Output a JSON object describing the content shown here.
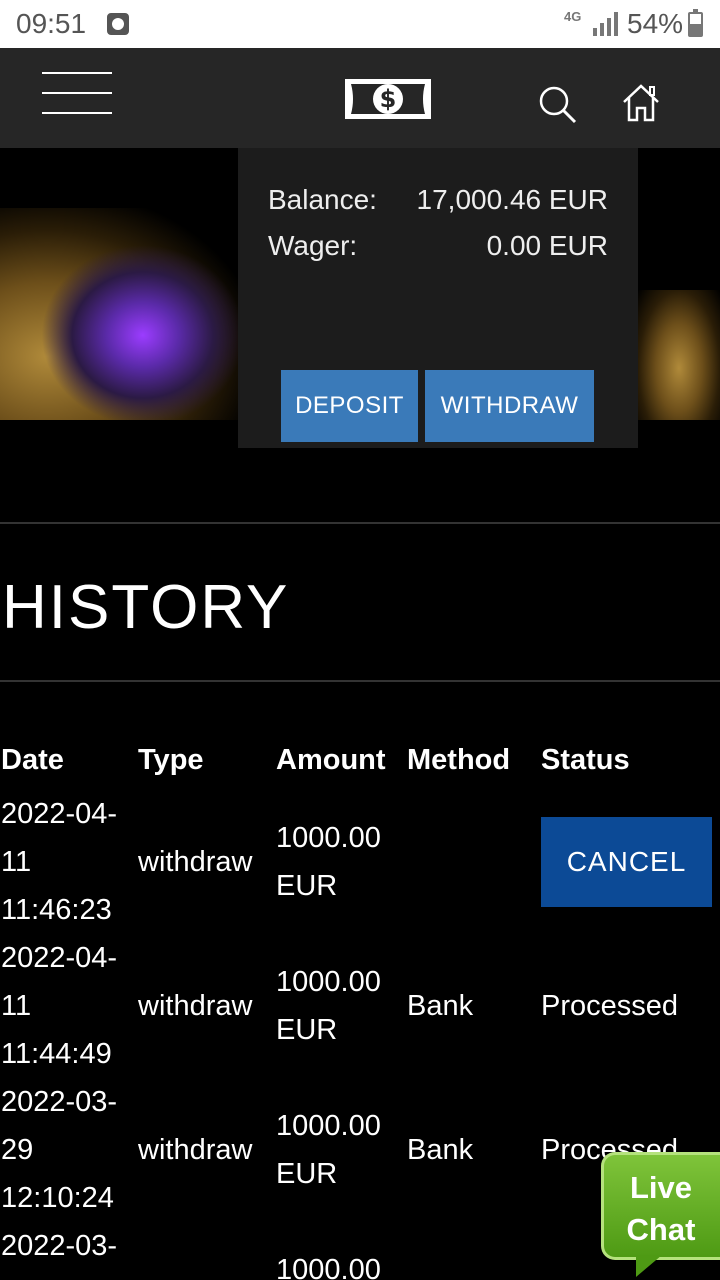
{
  "status_bar": {
    "time": "09:51",
    "network": "4G",
    "battery": "54%",
    "battery_level": 0.54
  },
  "nav": {
    "menu_icon": "hamburger-menu-icon",
    "logo_icon": "dollar-bill-icon",
    "search_icon": "search-icon",
    "home_icon": "home-icon"
  },
  "balance": {
    "balance_label": "Balance:",
    "balance_value": "17,000.46 EUR",
    "wager_label": "Wager:",
    "wager_value": "0.00 EUR",
    "deposit_label": "DEPOSIT",
    "withdraw_label": "WITHDRAW"
  },
  "history": {
    "title": "HISTORY",
    "columns": [
      "Date",
      "Type",
      "Amount",
      "Method",
      "Status"
    ],
    "rows": [
      {
        "date_line1": "2022-04-",
        "date_line2": "11",
        "date_line3": "11:46:23",
        "type": "withdraw",
        "amount_line1": "1000.00",
        "amount_line2": "EUR",
        "method": "",
        "status": "CANCEL"
      },
      {
        "date_line1": "2022-04-",
        "date_line2": "11",
        "date_line3": "11:44:49",
        "type": "withdraw",
        "amount_line1": "1000.00",
        "amount_line2": "EUR",
        "method": "Bank",
        "status": "Processed"
      },
      {
        "date_line1": "2022-03-",
        "date_line2": "29",
        "date_line3": "12:10:24",
        "type": "withdraw",
        "amount_line1": "1000.00",
        "amount_line2": "EUR",
        "method": "Bank",
        "status": "Processed"
      },
      {
        "date_line1": "2022-03-",
        "amount_line1": "1000.00"
      }
    ]
  },
  "live_chat": {
    "line1": "Live",
    "line2": "Chat"
  },
  "colors": {
    "accent": "#3a7ab9",
    "cancel": "#0c4a96",
    "chat": "#5aa61c",
    "nav_bg": "#262626"
  }
}
